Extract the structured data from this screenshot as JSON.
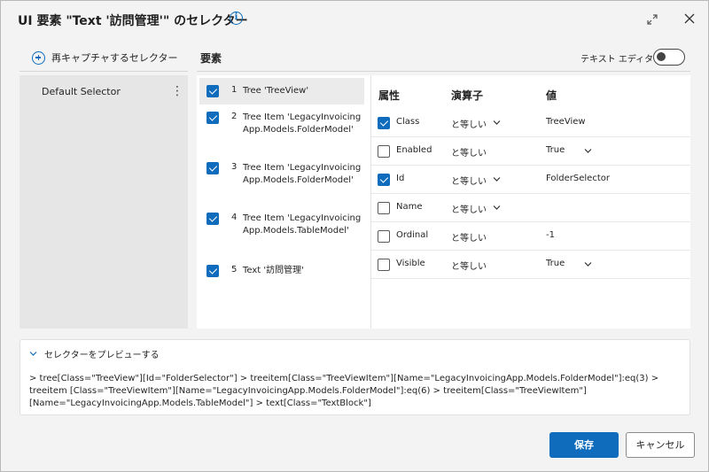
{
  "dialog": {
    "title": "UI 要素 \"Text '訪問管理'\" のセレクター"
  },
  "left": {
    "recapture_label": "再キャプチャするセレクター",
    "selectors": [
      {
        "label": "Default Selector"
      }
    ]
  },
  "elements": {
    "title": "要素",
    "text_editor_label": "テキスト エディター",
    "text_editor_on": false,
    "items": [
      {
        "num": "1",
        "text": "Tree 'TreeView'",
        "checked": true
      },
      {
        "num": "2",
        "text": "Tree Item 'LegacyInvoicingApp.Models.FolderModel'",
        "checked": true
      },
      {
        "num": "3",
        "text": "Tree Item 'LegacyInvoicingApp.Models.FolderModel'",
        "checked": true
      },
      {
        "num": "4",
        "text": "Tree Item 'LegacyInvoicingApp.Models.TableModel'",
        "checked": true
      },
      {
        "num": "5",
        "text": "Text '訪問管理'",
        "checked": true
      }
    ]
  },
  "attributes": {
    "headers": {
      "name": "属性",
      "operator": "演算子",
      "value": "値"
    },
    "rows": [
      {
        "name": "Class",
        "checked": true,
        "operator": "と等しい",
        "value": "TreeView"
      },
      {
        "name": "Enabled",
        "checked": false,
        "operator": "と等しい",
        "value": "True"
      },
      {
        "name": "Id",
        "checked": true,
        "operator": "と等しい",
        "value": "FolderSelector"
      },
      {
        "name": "Name",
        "checked": false,
        "operator": "と等しい",
        "value": ""
      },
      {
        "name": "Ordinal",
        "checked": false,
        "operator": "と等しい",
        "value": "-1"
      },
      {
        "name": "Visible",
        "checked": false,
        "operator": "と等しい",
        "value": "True"
      }
    ]
  },
  "preview": {
    "header": "セレクターをプレビューする",
    "text": " > tree[Class=\"TreeView\"][Id=\"FolderSelector\"] > treeitem[Class=\"TreeViewItem\"][Name=\"LegacyInvoicingApp.Models.FolderModel\"]:eq(3) > treeitem [Class=\"TreeViewItem\"][Name=\"LegacyInvoicingApp.Models.FolderModel\"]:eq(6) > treeitem[Class=\"TreeViewItem\"] [Name=\"LegacyInvoicingApp.Models.TableModel\"] > text[Class=\"TextBlock\"]"
  },
  "buttons": {
    "save": "保存",
    "cancel": "キャンセル"
  },
  "colors": {
    "accent": "#0f6cbd"
  }
}
